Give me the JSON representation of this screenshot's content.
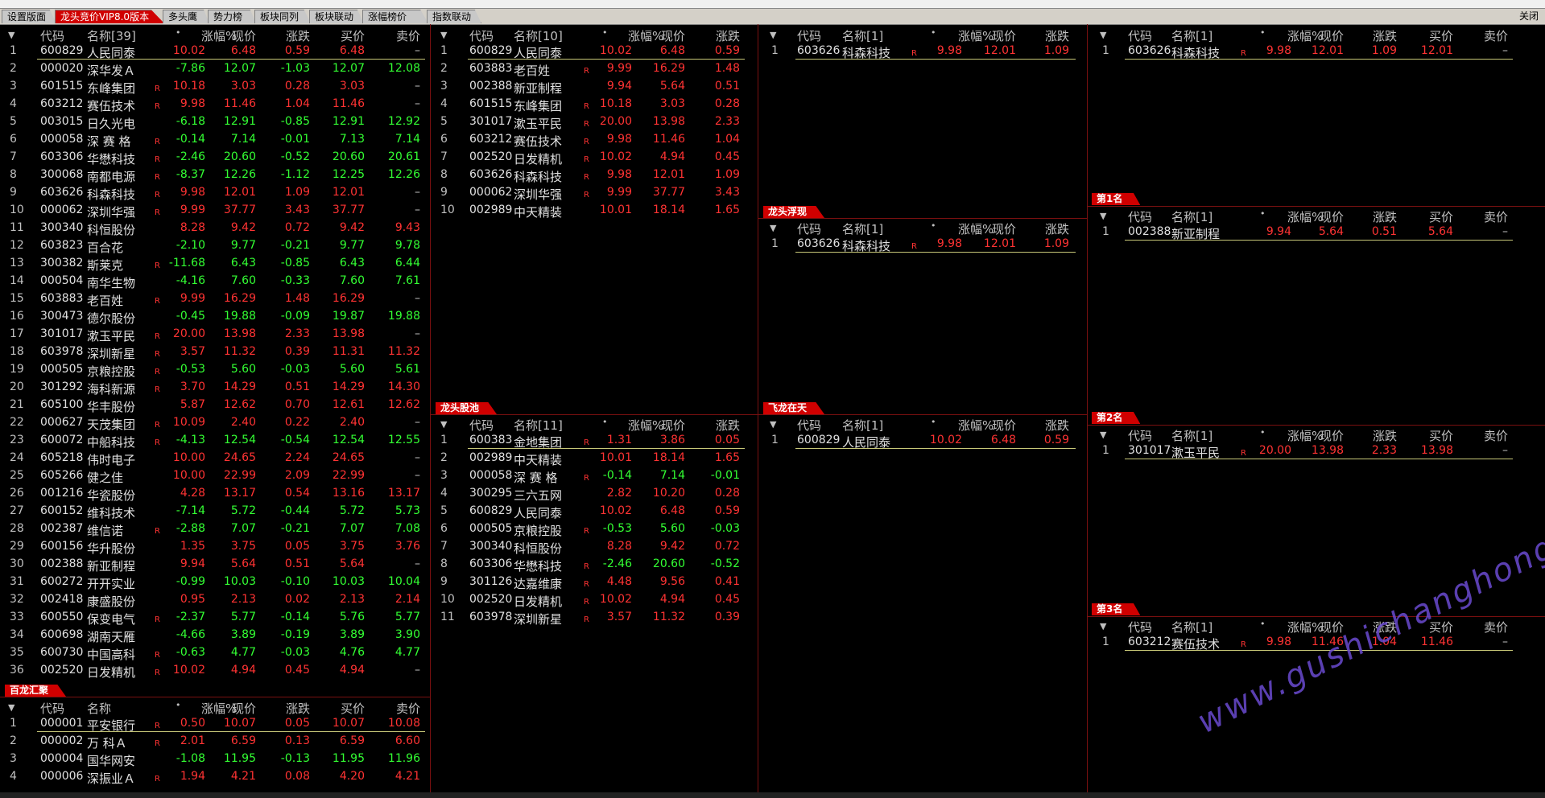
{
  "tabs": [
    "设置版面",
    "龙头竞价VIP8.0版本",
    "多头鹰",
    "势力榜",
    "板块同列",
    "板块联动",
    "涨幅榜价",
    "指数联动"
  ],
  "active_tab": 1,
  "close_label": "关闭",
  "columns": {
    "code": "代码",
    "name": "名称",
    "chg_pct": "涨幅%",
    "price": "现价",
    "chg": "涨跌",
    "bid": "买价",
    "ask": "卖价"
  },
  "panels": {
    "main": {
      "count": "[39]",
      "rows": [
        [
          "1",
          "600829",
          "人民同泰",
          "",
          "10.02",
          "6.48",
          "0.59",
          "6.48",
          "–"
        ],
        [
          "2",
          "000020",
          "深华发Ａ",
          "",
          "-7.86",
          "12.07",
          "-1.03",
          "12.07",
          "12.08"
        ],
        [
          "3",
          "601515",
          "东峰集团",
          "R",
          "10.18",
          "3.03",
          "0.28",
          "3.03",
          "–"
        ],
        [
          "4",
          "603212",
          "赛伍技术",
          "R",
          "9.98",
          "11.46",
          "1.04",
          "11.46",
          "–"
        ],
        [
          "5",
          "003015",
          "日久光电",
          "",
          "-6.18",
          "12.91",
          "-0.85",
          "12.91",
          "12.92"
        ],
        [
          "6",
          "000058",
          "深 赛 格",
          "R",
          "-0.14",
          "7.14",
          "-0.01",
          "7.13",
          "7.14"
        ],
        [
          "7",
          "603306",
          "华懋科技",
          "R",
          "-2.46",
          "20.60",
          "-0.52",
          "20.60",
          "20.61"
        ],
        [
          "8",
          "300068",
          "南都电源",
          "R",
          "-8.37",
          "12.26",
          "-1.12",
          "12.25",
          "12.26"
        ],
        [
          "9",
          "603626",
          "科森科技",
          "R",
          "9.98",
          "12.01",
          "1.09",
          "12.01",
          "–"
        ],
        [
          "10",
          "000062",
          "深圳华强",
          "R",
          "9.99",
          "37.77",
          "3.43",
          "37.77",
          "–"
        ],
        [
          "11",
          "300340",
          "科恒股份",
          "",
          "8.28",
          "9.42",
          "0.72",
          "9.42",
          "9.43"
        ],
        [
          "12",
          "603823",
          "百合花",
          "",
          "-2.10",
          "9.77",
          "-0.21",
          "9.77",
          "9.78"
        ],
        [
          "13",
          "300382",
          "斯莱克",
          "R",
          "-11.68",
          "6.43",
          "-0.85",
          "6.43",
          "6.44"
        ],
        [
          "14",
          "000504",
          "南华生物",
          "",
          "-4.16",
          "7.60",
          "-0.33",
          "7.60",
          "7.61"
        ],
        [
          "15",
          "603883",
          "老百姓",
          "R",
          "9.99",
          "16.29",
          "1.48",
          "16.29",
          "–"
        ],
        [
          "16",
          "300473",
          "德尔股份",
          "",
          "-0.45",
          "19.88",
          "-0.09",
          "19.87",
          "19.88"
        ],
        [
          "17",
          "301017",
          "漱玉平民",
          "R",
          "20.00",
          "13.98",
          "2.33",
          "13.98",
          "–"
        ],
        [
          "18",
          "603978",
          "深圳新星",
          "R",
          "3.57",
          "11.32",
          "0.39",
          "11.31",
          "11.32"
        ],
        [
          "19",
          "000505",
          "京粮控股",
          "R",
          "-0.53",
          "5.60",
          "-0.03",
          "5.60",
          "5.61"
        ],
        [
          "20",
          "301292",
          "海科新源",
          "R",
          "3.70",
          "14.29",
          "0.51",
          "14.29",
          "14.30"
        ],
        [
          "21",
          "605100",
          "华丰股份",
          "",
          "5.87",
          "12.62",
          "0.70",
          "12.61",
          "12.62"
        ],
        [
          "22",
          "000627",
          "天茂集团",
          "R",
          "10.09",
          "2.40",
          "0.22",
          "2.40",
          "–"
        ],
        [
          "23",
          "600072",
          "中船科技",
          "R",
          "-4.13",
          "12.54",
          "-0.54",
          "12.54",
          "12.55"
        ],
        [
          "24",
          "605218",
          "伟时电子",
          "",
          "10.00",
          "24.65",
          "2.24",
          "24.65",
          "–"
        ],
        [
          "25",
          "605266",
          "健之佳",
          "",
          "10.00",
          "22.99",
          "2.09",
          "22.99",
          "–"
        ],
        [
          "26",
          "001216",
          "华瓷股份",
          "",
          "4.28",
          "13.17",
          "0.54",
          "13.16",
          "13.17"
        ],
        [
          "27",
          "600152",
          "维科技术",
          "",
          "-7.14",
          "5.72",
          "-0.44",
          "5.72",
          "5.73"
        ],
        [
          "28",
          "002387",
          "维信诺",
          "R",
          "-2.88",
          "7.07",
          "-0.21",
          "7.07",
          "7.08"
        ],
        [
          "29",
          "600156",
          "华升股份",
          "",
          "1.35",
          "3.75",
          "0.05",
          "3.75",
          "3.76"
        ],
        [
          "30",
          "002388",
          "新亚制程",
          "",
          "9.94",
          "5.64",
          "0.51",
          "5.64",
          "–"
        ],
        [
          "31",
          "600272",
          "开开实业",
          "",
          "-0.99",
          "10.03",
          "-0.10",
          "10.03",
          "10.04"
        ],
        [
          "32",
          "002418",
          "康盛股份",
          "",
          "0.95",
          "2.13",
          "0.02",
          "2.13",
          "2.14"
        ],
        [
          "33",
          "600550",
          "保变电气",
          "R",
          "-2.37",
          "5.77",
          "-0.14",
          "5.76",
          "5.77"
        ],
        [
          "34",
          "600698",
          "湖南天雁",
          "",
          "-4.66",
          "3.89",
          "-0.19",
          "3.89",
          "3.90"
        ],
        [
          "35",
          "600730",
          "中国高科",
          "R",
          "-0.63",
          "4.77",
          "-0.03",
          "4.76",
          "4.77"
        ],
        [
          "36",
          "002520",
          "日发精机",
          "R",
          "10.02",
          "4.94",
          "0.45",
          "4.94",
          "–"
        ]
      ]
    },
    "bailong": {
      "label": "百龙汇聚",
      "rows": [
        [
          "1",
          "000001",
          "平安银行",
          "R",
          "0.50",
          "10.07",
          "0.05",
          "10.07",
          "10.08"
        ],
        [
          "2",
          "000002",
          "万 科Ａ",
          "R",
          "2.01",
          "6.59",
          "0.13",
          "6.59",
          "6.60"
        ],
        [
          "3",
          "000004",
          "国华网安",
          "",
          "-1.08",
          "11.95",
          "-0.13",
          "11.95",
          "11.96"
        ],
        [
          "4",
          "000006",
          "深振业Ａ",
          "R",
          "1.94",
          "4.21",
          "0.08",
          "4.20",
          "4.21"
        ]
      ]
    },
    "mid_top": {
      "count": "[10]",
      "rows": [
        [
          "1",
          "600829",
          "人民同泰",
          "",
          "10.02",
          "6.48",
          "0.59"
        ],
        [
          "2",
          "603883",
          "老百姓",
          "R",
          "9.99",
          "16.29",
          "1.48"
        ],
        [
          "3",
          "002388",
          "新亚制程",
          "",
          "9.94",
          "5.64",
          "0.51"
        ],
        [
          "4",
          "601515",
          "东峰集团",
          "R",
          "10.18",
          "3.03",
          "0.28"
        ],
        [
          "5",
          "301017",
          "漱玉平民",
          "R",
          "20.00",
          "13.98",
          "2.33"
        ],
        [
          "6",
          "603212",
          "赛伍技术",
          "R",
          "9.98",
          "11.46",
          "1.04"
        ],
        [
          "7",
          "002520",
          "日发精机",
          "R",
          "10.02",
          "4.94",
          "0.45"
        ],
        [
          "8",
          "603626",
          "科森科技",
          "R",
          "9.98",
          "12.01",
          "1.09"
        ],
        [
          "9",
          "000062",
          "深圳华强",
          "R",
          "9.99",
          "37.77",
          "3.43"
        ],
        [
          "10",
          "002989",
          "中天精装",
          "",
          "10.01",
          "18.14",
          "1.65"
        ]
      ]
    },
    "longtou_gu": {
      "label": "龙头股池",
      "count": "[11]",
      "rows": [
        [
          "1",
          "600383",
          "金地集团",
          "R",
          "1.31",
          "3.86",
          "0.05"
        ],
        [
          "2",
          "002989",
          "中天精装",
          "",
          "10.01",
          "18.14",
          "1.65"
        ],
        [
          "3",
          "000058",
          "深 赛 格",
          "R",
          "-0.14",
          "7.14",
          "-0.01"
        ],
        [
          "4",
          "300295",
          "三六五网",
          "",
          "2.82",
          "10.20",
          "0.28"
        ],
        [
          "5",
          "600829",
          "人民同泰",
          "",
          "10.02",
          "6.48",
          "0.59"
        ],
        [
          "6",
          "000505",
          "京粮控股",
          "R",
          "-0.53",
          "5.60",
          "-0.03"
        ],
        [
          "7",
          "300340",
          "科恒股份",
          "",
          "8.28",
          "9.42",
          "0.72"
        ],
        [
          "8",
          "603306",
          "华懋科技",
          "R",
          "-2.46",
          "20.60",
          "-0.52"
        ],
        [
          "9",
          "301126",
          "达嘉维康",
          "R",
          "4.48",
          "9.56",
          "0.41"
        ],
        [
          "10",
          "002520",
          "日发精机",
          "R",
          "10.02",
          "4.94",
          "0.45"
        ],
        [
          "11",
          "603978",
          "深圳新星",
          "R",
          "3.57",
          "11.32",
          "0.39"
        ]
      ]
    },
    "c3_top": {
      "count": "[1]",
      "rows": [
        [
          "1",
          "603626",
          "科森科技",
          "R",
          "9.98",
          "12.01",
          "1.09"
        ]
      ]
    },
    "longtou_fuxian": {
      "label": "龙头浮现",
      "count": "[1]",
      "rows": [
        [
          "1",
          "603626",
          "科森科技",
          "R",
          "9.98",
          "12.01",
          "1.09"
        ]
      ]
    },
    "feilong": {
      "label": "飞龙在天",
      "count": "[1]",
      "rows": [
        [
          "1",
          "600829",
          "人民同泰",
          "",
          "10.02",
          "6.48",
          "0.59"
        ]
      ]
    },
    "r_top": {
      "count": "[1]",
      "rows": [
        [
          "1",
          "603626",
          "科森科技",
          "R",
          "9.98",
          "12.01",
          "1.09",
          "12.01",
          "–"
        ]
      ]
    },
    "rank1": {
      "label": "第1名",
      "count": "[1]",
      "rows": [
        [
          "1",
          "002388",
          "新亚制程",
          "",
          "9.94",
          "5.64",
          "0.51",
          "5.64",
          "–"
        ]
      ]
    },
    "rank2": {
      "label": "第2名",
      "count": "[1]",
      "rows": [
        [
          "1",
          "301017",
          "漱玉平民",
          "R",
          "20.00",
          "13.98",
          "2.33",
          "13.98",
          "–"
        ]
      ]
    },
    "rank3": {
      "label": "第3名",
      "count": "[1]",
      "rows": [
        [
          "1",
          "603212",
          "赛伍技术",
          "R",
          "9.98",
          "11.46",
          "1.04",
          "11.46",
          "–"
        ]
      ]
    }
  },
  "watermark": "www.gushichanghong.com",
  "colors": {
    "up": "#ff3333",
    "down": "#33ff33",
    "label_bg": "#d00000",
    "divider": "#7a1010"
  }
}
